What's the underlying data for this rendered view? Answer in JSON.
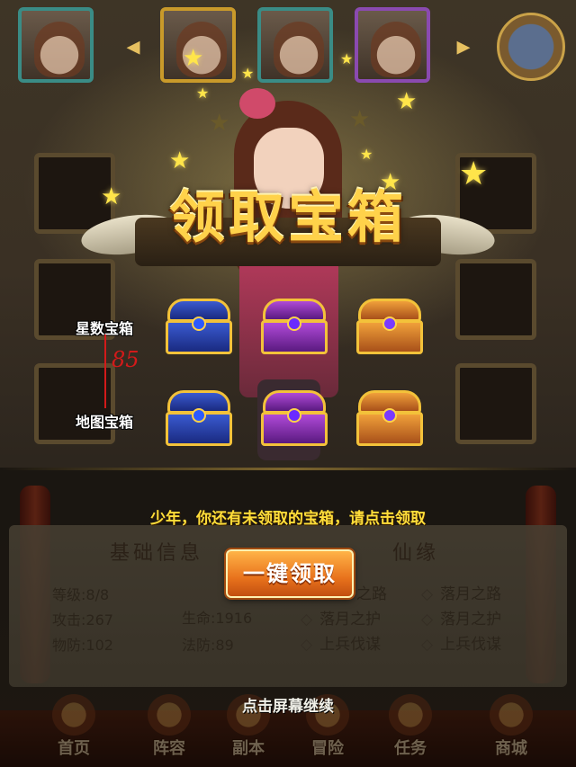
{
  "banner": {
    "title": "领取宝箱"
  },
  "chest_labels": {
    "star": "星数宝箱",
    "map": "地图宝箱",
    "handwritten_note": "85"
  },
  "chests": {
    "row1": [
      "blue",
      "purple",
      "orange"
    ],
    "row2": [
      "blue",
      "purple",
      "orange"
    ]
  },
  "prompt": "少年，你还有未领取的宝箱，请点击领取",
  "claim_button": "一键领取",
  "panel": {
    "basic_title": "基础信息",
    "fate_title": "仙缘",
    "stats": {
      "level_label": "等级:",
      "level_value": "8/8",
      "attack_label": "攻击:",
      "attack_value": "267",
      "hp_label": "生命:",
      "hp_value": "1916",
      "pdef_label": "物防:",
      "pdef_value": "102",
      "mdef_label": "法防:",
      "mdef_value": "89"
    },
    "fate_col1": [
      "之路",
      "落月之护",
      "上兵伐谋"
    ],
    "fate_col2": [
      "落月之路",
      "落月之护",
      "上兵伐谋"
    ]
  },
  "continue_text": "点击屏幕继续",
  "bottom_nav": [
    "首页",
    "阵容",
    "副本",
    "冒险",
    "任务",
    "商城"
  ],
  "colors": {
    "accent_gold": "#ffd24a",
    "prompt_yellow": "#ffde3a",
    "button_orange": "#e8721c"
  }
}
